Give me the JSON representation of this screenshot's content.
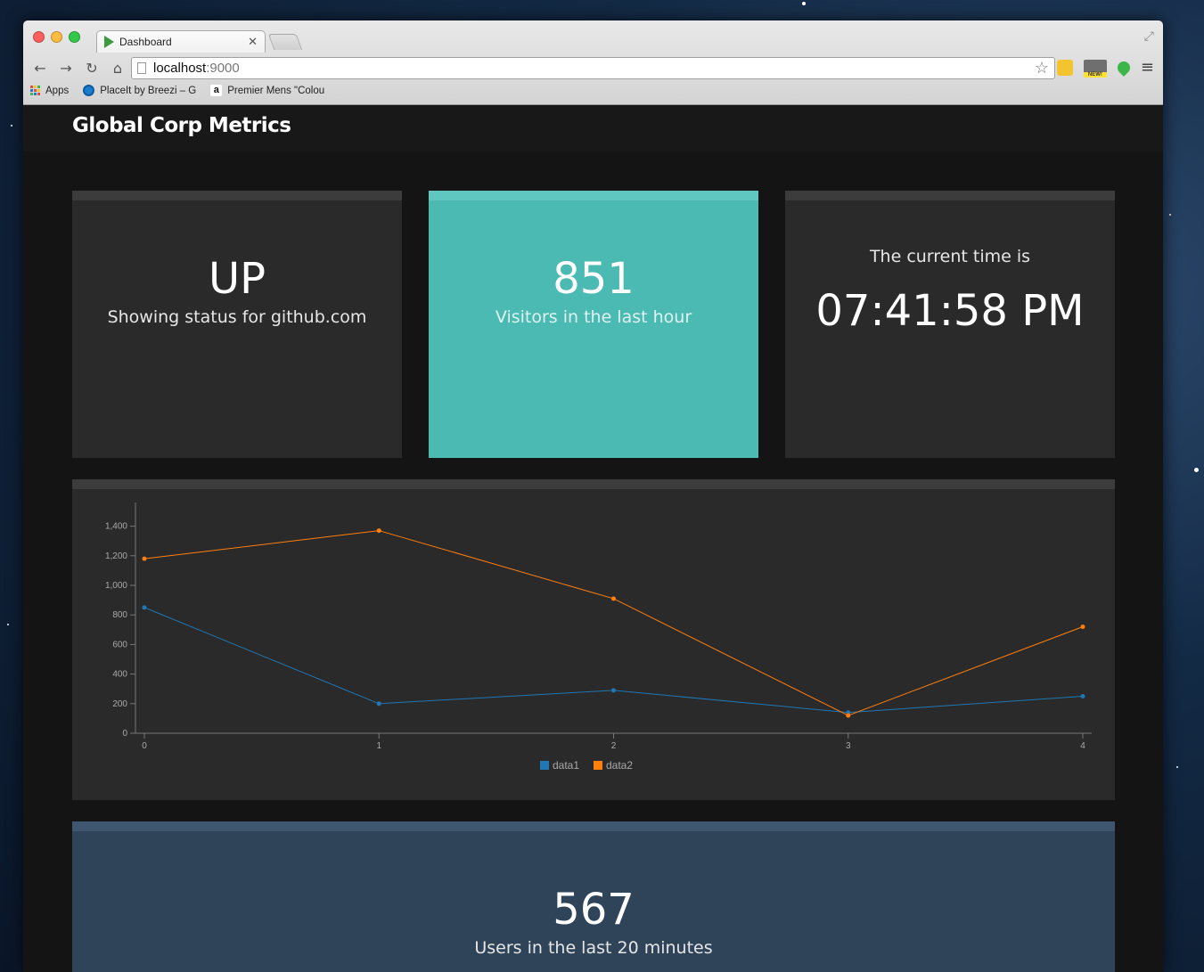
{
  "browser": {
    "tab_title": "Dashboard",
    "url_host": "localhost",
    "url_port": ":9000",
    "bookmarks": [
      {
        "label": "Apps"
      },
      {
        "label": "PlaceIt by Breezi – G"
      },
      {
        "label": "Premier Mens \"Colou"
      }
    ]
  },
  "dashboard": {
    "title": "Global Corp Metrics",
    "status": {
      "value": "UP",
      "label": "Showing status for github.com"
    },
    "visitors": {
      "value": "851",
      "label": "Visitors in the last hour"
    },
    "time": {
      "title": "The current time is",
      "value": "07:41:58 PM"
    },
    "users": {
      "value": "567",
      "label": "Users in the last 20 minutes"
    }
  },
  "colors": {
    "visitors_bg": "#4abab2",
    "users_bg": "#2f4459",
    "series1": "#1f77b4",
    "series2": "#ff7f0e"
  },
  "chart_data": {
    "type": "line",
    "x": [
      0,
      1,
      2,
      3,
      4
    ],
    "series": [
      {
        "name": "data1",
        "values": [
          850,
          200,
          290,
          140,
          250
        ]
      },
      {
        "name": "data2",
        "values": [
          1180,
          1370,
          910,
          120,
          720
        ]
      }
    ],
    "yticks": [
      0,
      200,
      400,
      600,
      800,
      1000,
      1200,
      1400
    ],
    "ytick_labels": [
      "0",
      "200",
      "400",
      "600",
      "800",
      "1,000",
      "1,200",
      "1,400"
    ],
    "xtick_labels": [
      "0",
      "1",
      "2",
      "3",
      "4"
    ],
    "ylim": [
      0,
      1500
    ],
    "legend_position": "bottom-center",
    "grid": false
  }
}
